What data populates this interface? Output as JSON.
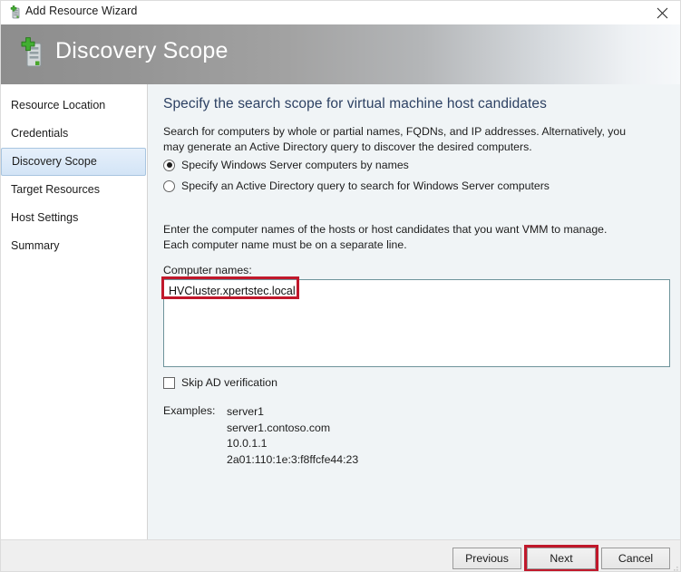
{
  "titlebar": {
    "title": "Add Resource Wizard",
    "icon": "add-server-icon",
    "close_label": "✕"
  },
  "header": {
    "title": "Discovery Scope",
    "icon": "add-server-icon"
  },
  "sidebar": {
    "items": [
      {
        "label": "Resource Location",
        "selected": false
      },
      {
        "label": "Credentials",
        "selected": false
      },
      {
        "label": "Discovery Scope",
        "selected": true
      },
      {
        "label": "Target Resources",
        "selected": false
      },
      {
        "label": "Host Settings",
        "selected": false
      },
      {
        "label": "Summary",
        "selected": false
      }
    ]
  },
  "main": {
    "heading": "Specify the search scope for virtual machine host candidates",
    "description": "Search for computers by whole or partial names, FQDNs, and IP addresses. Alternatively, you may generate an Active Directory query to discover the desired computers.",
    "radio_options": [
      {
        "label": "Specify Windows Server computers by names",
        "selected": true
      },
      {
        "label": "Specify an Active Directory query to search for Windows Server computers",
        "selected": false
      }
    ],
    "instructions": "Enter the computer names of the hosts or host candidates that you want VMM to manage. Each computer name must be on a separate line.",
    "computer_names_label": "Computer names:",
    "computer_names_value": "HVCluster.xpertstec.local",
    "skip_ad_verification": {
      "label": "Skip AD verification",
      "checked": false
    },
    "examples_label": "Examples:",
    "examples": [
      "server1",
      "server1.contoso.com",
      "10.0.1.1",
      "2a01:110:1e:3:f8ffcfe44:23"
    ]
  },
  "footer": {
    "previous_label": "Previous",
    "next_label": "Next",
    "cancel_label": "Cancel"
  },
  "annotations": {
    "color": "#c0182b",
    "targets": [
      "computer-names-input",
      "next-button"
    ]
  },
  "colors": {
    "heading": "#2d4163",
    "content_bg": "#f0f4f6",
    "selected_nav": "#d3e4f6",
    "input_border": "#6e939b",
    "footer_bg": "#efefef"
  }
}
